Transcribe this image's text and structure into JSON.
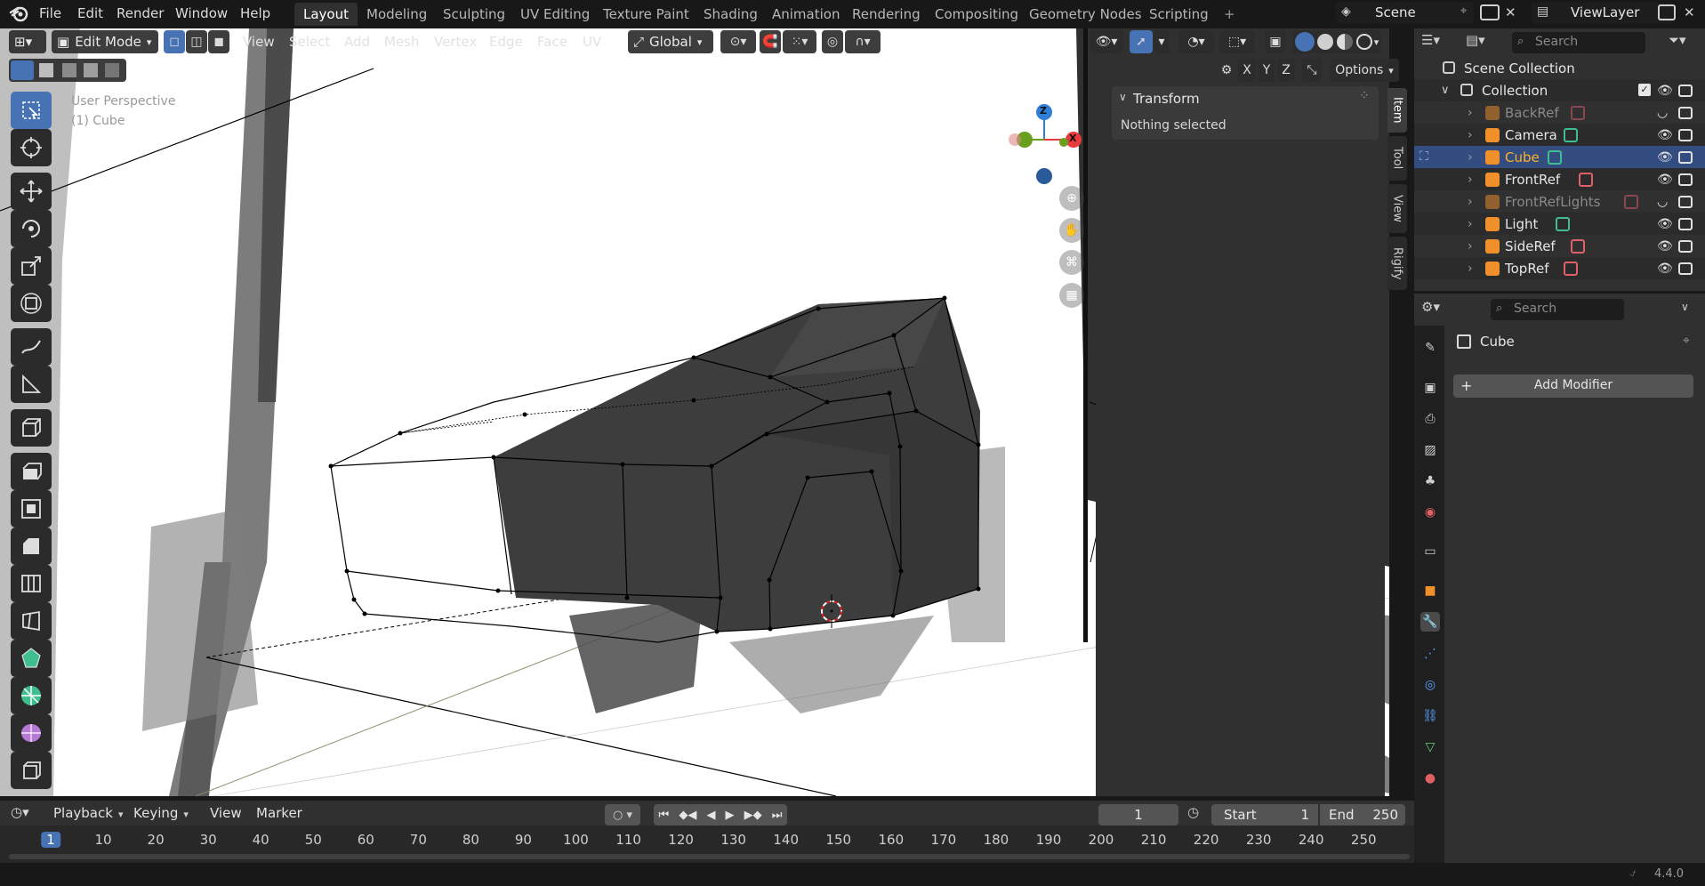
{
  "topbar": {
    "menus": [
      "File",
      "Edit",
      "Render",
      "Window",
      "Help"
    ],
    "workspaces": [
      "Layout",
      "Modeling",
      "Sculpting",
      "UV Editing",
      "Texture Paint",
      "Shading",
      "Animation",
      "Rendering",
      "Compositing",
      "Geometry Nodes",
      "Scripting"
    ],
    "add_workspace": "+",
    "scene_label": "Scene",
    "viewlayer_label": "ViewLayer"
  },
  "viewport_header": {
    "mode": "Edit Mode",
    "menus": [
      "View",
      "Select",
      "Add",
      "Mesh",
      "Vertex",
      "Edge",
      "Face",
      "UV"
    ],
    "transform_orientation": "Global",
    "axes": [
      "X",
      "Y",
      "Z"
    ],
    "options_label": "Options"
  },
  "viewport": {
    "overlay_line1": "User Perspective",
    "overlay_line2": "(1) Cube",
    "gizmo": {
      "x": "X",
      "y": "Y",
      "z": "Z"
    },
    "colors": {
      "x_axis": "#e83b3b",
      "y_axis": "#6a9e1f",
      "z_axis": "#2f7fd6",
      "mesh": "#3d3d3d",
      "background": "#ffffff"
    }
  },
  "npanel": {
    "section_title": "Transform",
    "empty_text": "Nothing selected",
    "tabs": [
      "Item",
      "Tool",
      "View",
      "Rigify"
    ]
  },
  "outliner": {
    "search_placeholder": "Search",
    "scene_collection": "Scene Collection",
    "collection": "Collection",
    "items": [
      {
        "name": "BackRef",
        "icon": "image-empty-icon",
        "dim": true,
        "visible": false
      },
      {
        "name": "Camera",
        "icon": "camera-icon",
        "dim": false,
        "visible": true
      },
      {
        "name": "Cube",
        "icon": "mesh-icon",
        "dim": false,
        "visible": true,
        "selected": true
      },
      {
        "name": "FrontRef",
        "icon": "image-empty-icon",
        "dim": false,
        "visible": true
      },
      {
        "name": "FrontRefLights",
        "icon": "image-empty-icon",
        "dim": true,
        "visible": false
      },
      {
        "name": "Light",
        "icon": "light-icon",
        "dim": false,
        "visible": true
      },
      {
        "name": "SideRef",
        "icon": "image-empty-icon",
        "dim": false,
        "visible": true
      },
      {
        "name": "TopRef",
        "icon": "image-empty-icon",
        "dim": false,
        "visible": true
      }
    ]
  },
  "properties": {
    "search_placeholder": "Search",
    "object_name": "Cube",
    "add_modifier": "Add Modifier"
  },
  "timeline": {
    "menus": [
      "Playback",
      "Keying",
      "View",
      "Marker"
    ],
    "current_frame": "1",
    "start_label": "Start",
    "start_value": "1",
    "end_label": "End",
    "end_value": "250",
    "ticks": [
      "1",
      "10",
      "20",
      "30",
      "40",
      "50",
      "60",
      "70",
      "80",
      "90",
      "100",
      "110",
      "120",
      "130",
      "140",
      "150",
      "160",
      "170",
      "180",
      "190",
      "200",
      "210",
      "220",
      "230",
      "240",
      "250"
    ]
  },
  "statusbar": {
    "version": "4.4.0"
  }
}
